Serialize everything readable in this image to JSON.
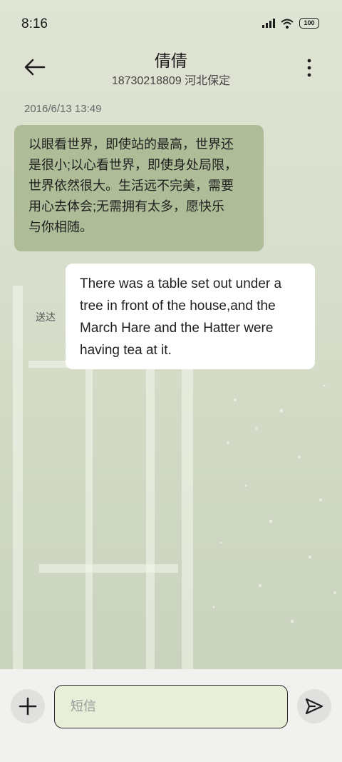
{
  "status_bar": {
    "time": "8:16",
    "battery": "100"
  },
  "header": {
    "contact_name": "倩倩",
    "contact_detail": "18730218809 河北保定"
  },
  "conversation": {
    "timestamp": "2016/6/13 13:49",
    "incoming_lines": [
      "以眼看世界，即使站的最高，世界还",
      "是很小;以心看世界，即使身处局限，",
      "世界依然很大。生活远不完美，需要",
      "用心去体会;无需拥有太多，愿快乐",
      "与你相随。"
    ],
    "outgoing_lines": [
      "There was a table set out under a",
      "tree in front of the house,and the",
      "March Hare and the Hatter were",
      "having tea at it."
    ],
    "delivery_status": "送达"
  },
  "composer": {
    "placeholder": "短信"
  },
  "icons": {
    "signal": "signal-icon",
    "wifi": "wifi-icon",
    "battery": "battery-icon",
    "back": "back-arrow-icon",
    "more": "more-vertical-icon",
    "add": "plus-icon",
    "send": "send-icon"
  },
  "colors": {
    "incoming_bubble": "#aebd97",
    "outgoing_bubble": "#ffffff",
    "background": "#dde2d2"
  }
}
